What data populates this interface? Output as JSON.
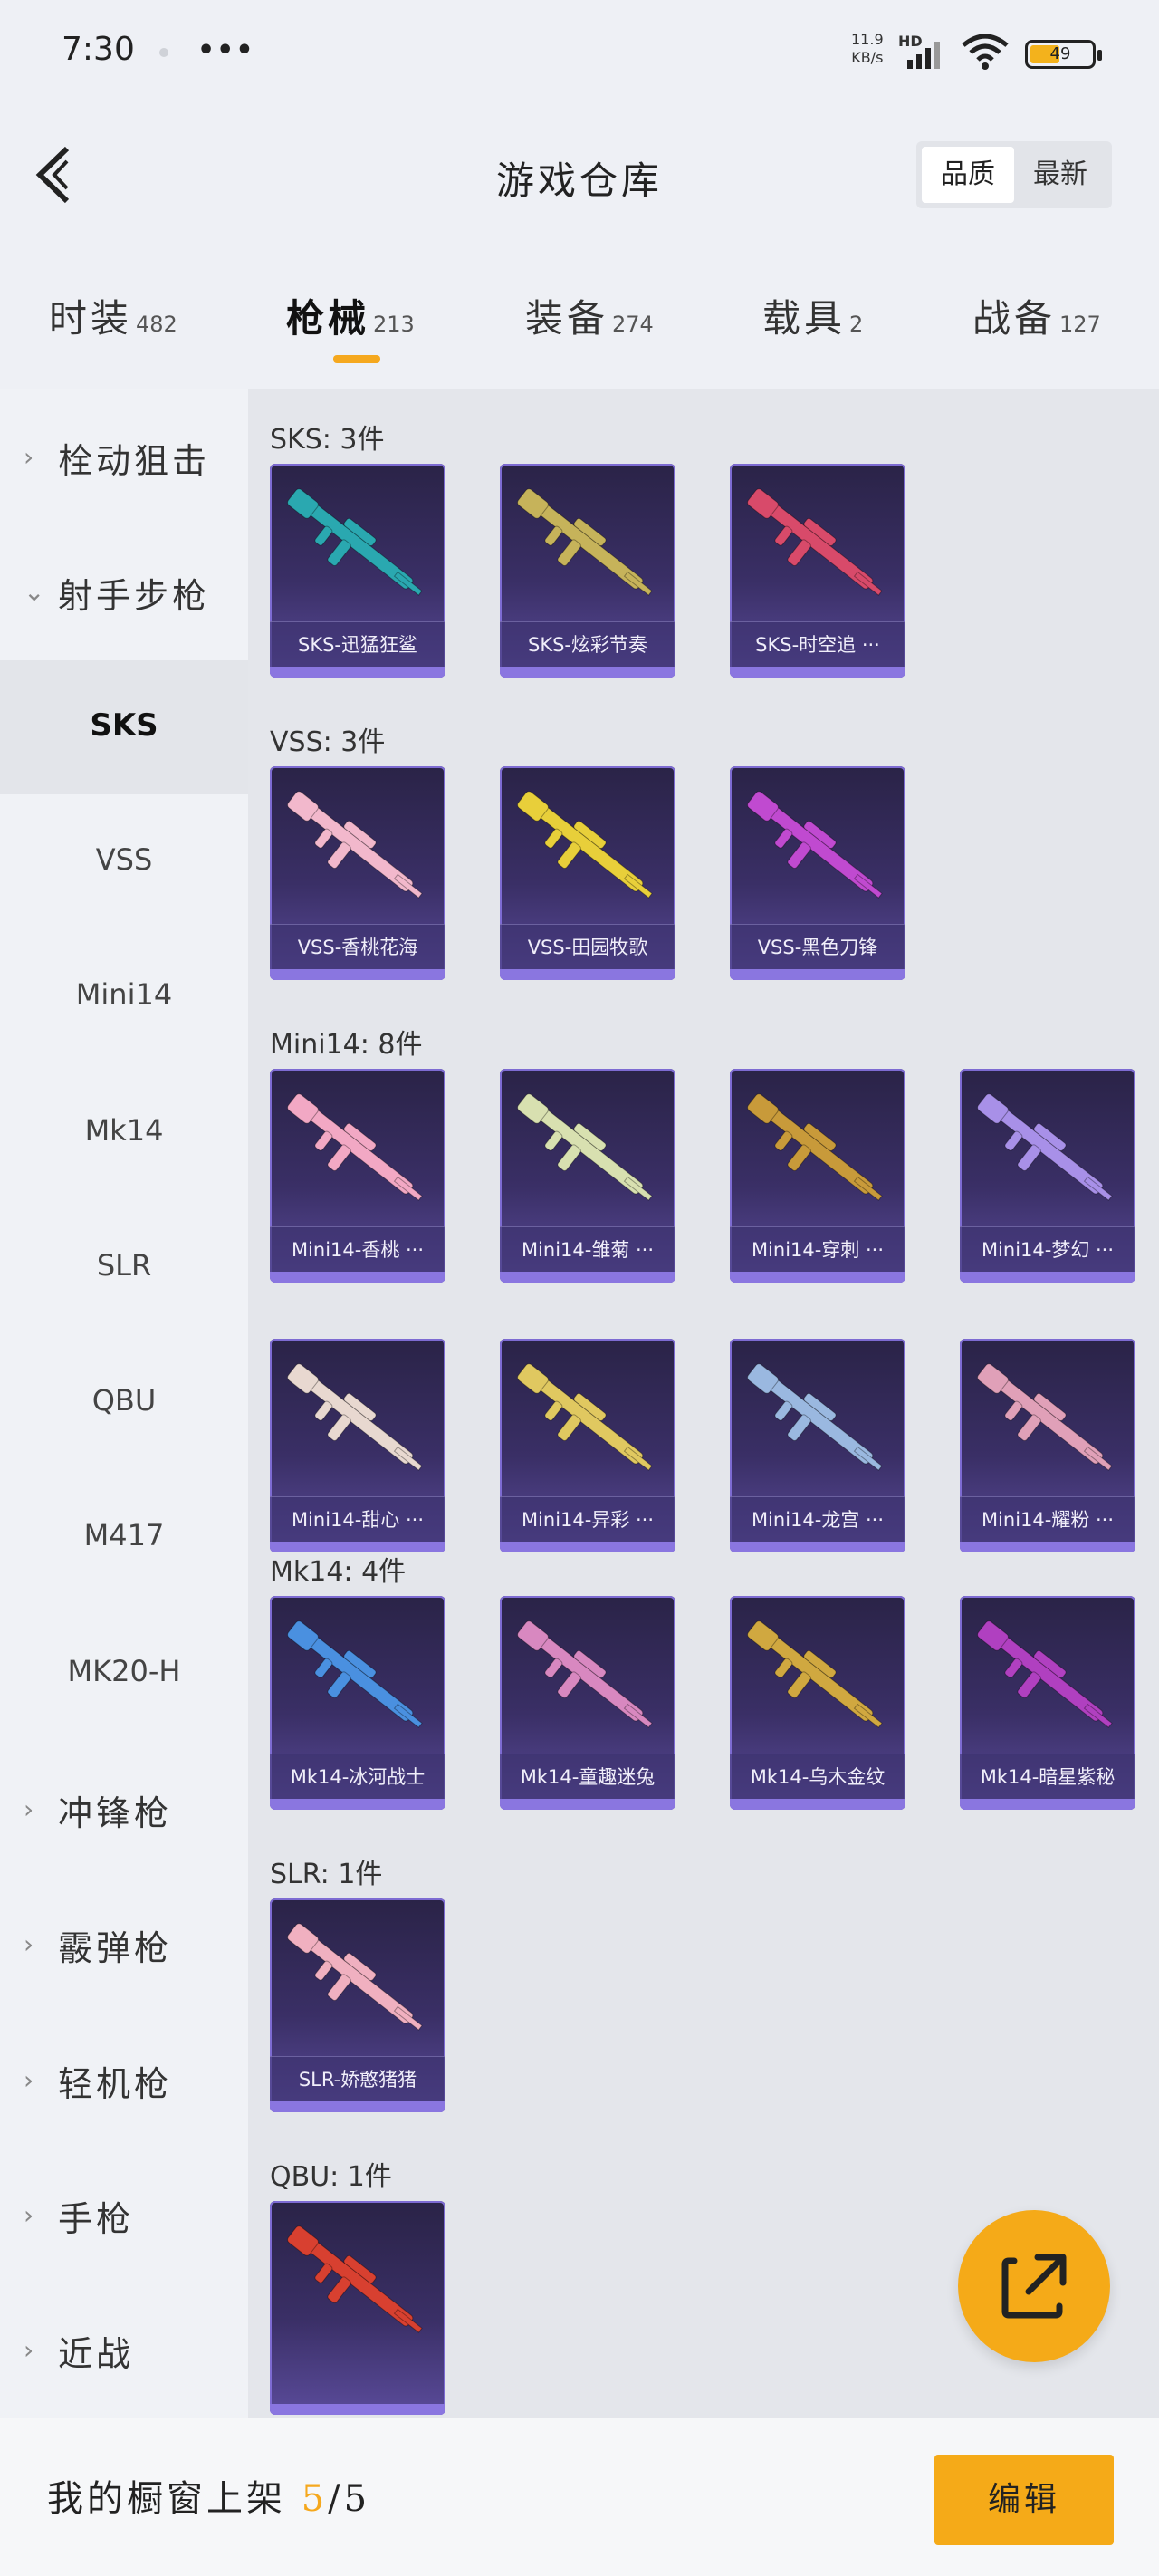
{
  "status_bar": {
    "time": "7:30",
    "more": "•••",
    "speed_value": "11.9",
    "speed_unit": "KB/s",
    "network": "HD",
    "battery": "49",
    "battery_level": 0.49
  },
  "header": {
    "title": "游戏仓库",
    "sort_options": [
      "品质",
      "最新"
    ],
    "active_sort": 0
  },
  "tabs": [
    {
      "label": "时装",
      "count": "482"
    },
    {
      "label": "枪械",
      "count": "213"
    },
    {
      "label": "装备",
      "count": "274"
    },
    {
      "label": "载具",
      "count": "2"
    },
    {
      "label": "战备",
      "count": "127"
    }
  ],
  "active_tab": 1,
  "sidebar": [
    {
      "type": "group",
      "label": "栓动狙击",
      "arrow": "›"
    },
    {
      "type": "group",
      "label": "射手步枪",
      "arrow": "⌄"
    },
    {
      "type": "sub",
      "label": "SKS",
      "active": true
    },
    {
      "type": "sub",
      "label": "VSS"
    },
    {
      "type": "sub",
      "label": "Mini14"
    },
    {
      "type": "sub",
      "label": "Mk14"
    },
    {
      "type": "sub",
      "label": "SLR"
    },
    {
      "type": "sub",
      "label": "QBU"
    },
    {
      "type": "sub",
      "label": "M417"
    },
    {
      "type": "sub",
      "label": "MK20-H"
    },
    {
      "type": "group",
      "label": "冲锋枪",
      "arrow": "›"
    },
    {
      "type": "group",
      "label": "霰弹枪",
      "arrow": "›"
    },
    {
      "type": "group",
      "label": "轻机枪",
      "arrow": "›"
    },
    {
      "type": "group",
      "label": "手枪",
      "arrow": "›"
    },
    {
      "type": "group",
      "label": "近战",
      "arrow": "›"
    }
  ],
  "sections": [
    {
      "title": "SKS: 3件",
      "items": [
        {
          "label": "SKS-迅猛狂鲨",
          "color": "#2aa8b0"
        },
        {
          "label": "SKS-炫彩节奏",
          "color": "#c6b35a"
        },
        {
          "label": "SKS-时空追 ···",
          "color": "#d84a6a"
        }
      ]
    },
    {
      "title": "VSS: 3件",
      "items": [
        {
          "label": "VSS-香桃花海",
          "color": "#f2b8cc"
        },
        {
          "label": "VSS-田园牧歌",
          "color": "#e8cf3a"
        },
        {
          "label": "VSS-黑色刀锋",
          "color": "#c04ad0"
        }
      ]
    },
    {
      "title": "Mini14: 8件",
      "items": [
        {
          "label": "Mini14-香桃 ···",
          "color": "#f2a8c4"
        },
        {
          "label": "Mini14-雏菊 ···",
          "color": "#d8e0b0"
        },
        {
          "label": "Mini14-穿刺 ···",
          "color": "#c89a3a"
        },
        {
          "label": "Mini14-梦幻 ···",
          "color": "#a890e8"
        },
        {
          "label": "Mini14-甜心 ···",
          "color": "#e8d8d0"
        },
        {
          "label": "Mini14-异彩 ···",
          "color": "#e0c860"
        },
        {
          "label": "Mini14-龙宫 ···",
          "color": "#9ab8e0"
        },
        {
          "label": "Mini14-耀粉 ···",
          "color": "#e0a0b8"
        }
      ]
    },
    {
      "title": "Mk14: 4件",
      "items": [
        {
          "label": "Mk14-冰河战士",
          "color": "#4a90e0"
        },
        {
          "label": "Mk14-童趣迷兔",
          "color": "#d888c0"
        },
        {
          "label": "Mk14-乌木金纹",
          "color": "#d0a840"
        },
        {
          "label": "Mk14-暗星紫秘",
          "color": "#b040c0"
        }
      ]
    },
    {
      "title": "SLR: 1件",
      "items": [
        {
          "label": "SLR-娇憨猪猪",
          "color": "#f0b0c0"
        }
      ]
    },
    {
      "title": "QBU: 1件",
      "items": [
        {
          "label": "",
          "color": "#d84030"
        }
      ]
    }
  ],
  "bottom_bar": {
    "label": "我的橱窗上架",
    "count_current": "5",
    "count_total": "/5",
    "edit_label": "编辑"
  }
}
